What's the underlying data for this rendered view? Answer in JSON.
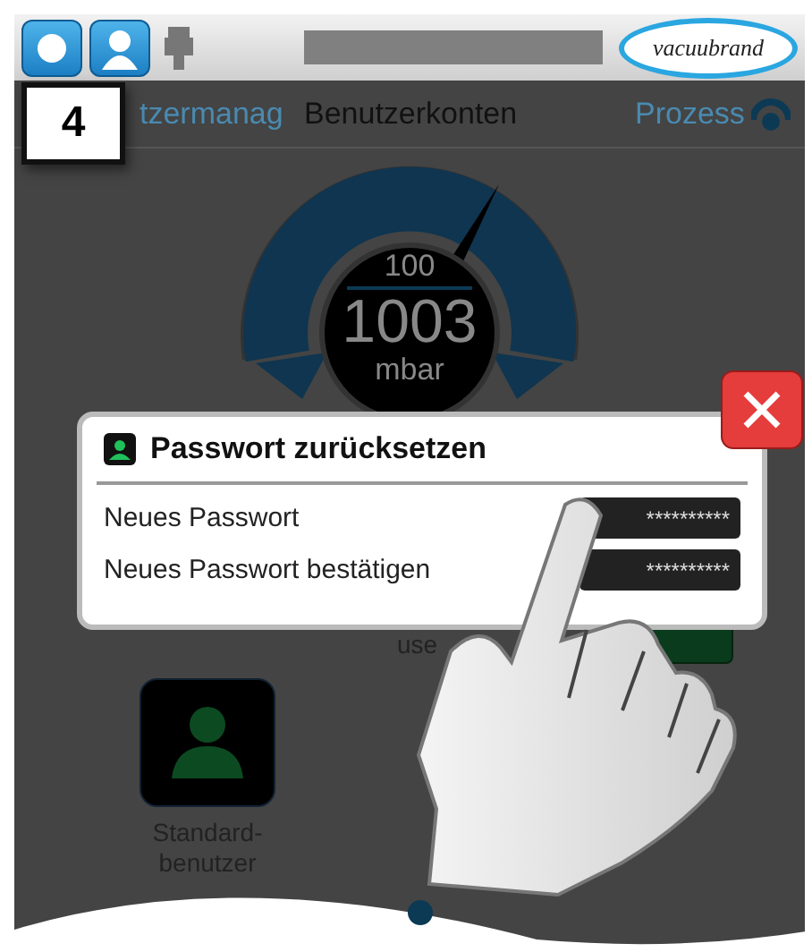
{
  "step_badge": "4",
  "top_bar": {
    "logo": "vacuubrand"
  },
  "nav": {
    "back_label": "tzermanag",
    "title": "Benutzerkonten",
    "forward_label": "Prozess"
  },
  "gauge": {
    "setpoint": "100",
    "value": "1003",
    "unit": "mbar"
  },
  "dialog": {
    "title": "Passwort zurücksetzen",
    "fields": [
      {
        "label": "Neues Passwort",
        "value": "**********"
      },
      {
        "label": "Neues Passwort bestätigen",
        "value": "**********"
      }
    ]
  },
  "background": {
    "partial_label": "use",
    "tiles": [
      {
        "label": "Standard-benutzer"
      }
    ]
  }
}
